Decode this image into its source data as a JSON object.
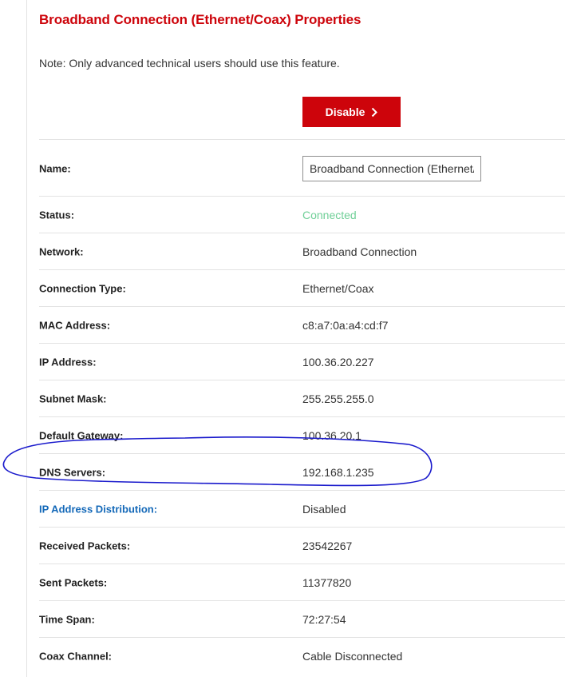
{
  "header": {
    "title": "Broadband Connection (Ethernet/Coax) Properties",
    "note": "Note: Only advanced technical users should use this feature."
  },
  "actions": {
    "disable_label": "Disable",
    "disable_icon": "chevron-right-icon"
  },
  "accent_color": "#cd040b",
  "link_color": "#1368b8",
  "status_color": "#6fcf97",
  "annotation_color": "#1a1acc",
  "name_field": {
    "label": "Name:",
    "value": "Broadband Connection (Ethernet/Coax)"
  },
  "properties": [
    {
      "label": "Status:",
      "value": "Connected"
    },
    {
      "label": "Network:",
      "value": "Broadband Connection"
    },
    {
      "label": "Connection Type:",
      "value": "Ethernet/Coax"
    },
    {
      "label": "MAC Address:",
      "value": "c8:a7:0a:a4:cd:f7"
    },
    {
      "label": "IP Address:",
      "value": "100.36.20.227"
    },
    {
      "label": "Subnet Mask:",
      "value": "255.255.255.0"
    },
    {
      "label": "Default Gateway:",
      "value": "100.36.20.1"
    },
    {
      "label": "DNS Servers:",
      "value": "192.168.1.235"
    },
    {
      "label": "IP Address Distribution:",
      "value": "Disabled"
    },
    {
      "label": "Received Packets:",
      "value": "23542267"
    },
    {
      "label": "Sent Packets:",
      "value": "11377820"
    },
    {
      "label": "Time Span:",
      "value": "72:27:54"
    },
    {
      "label": "Coax Channel:",
      "value": "Cable Disconnected"
    }
  ]
}
